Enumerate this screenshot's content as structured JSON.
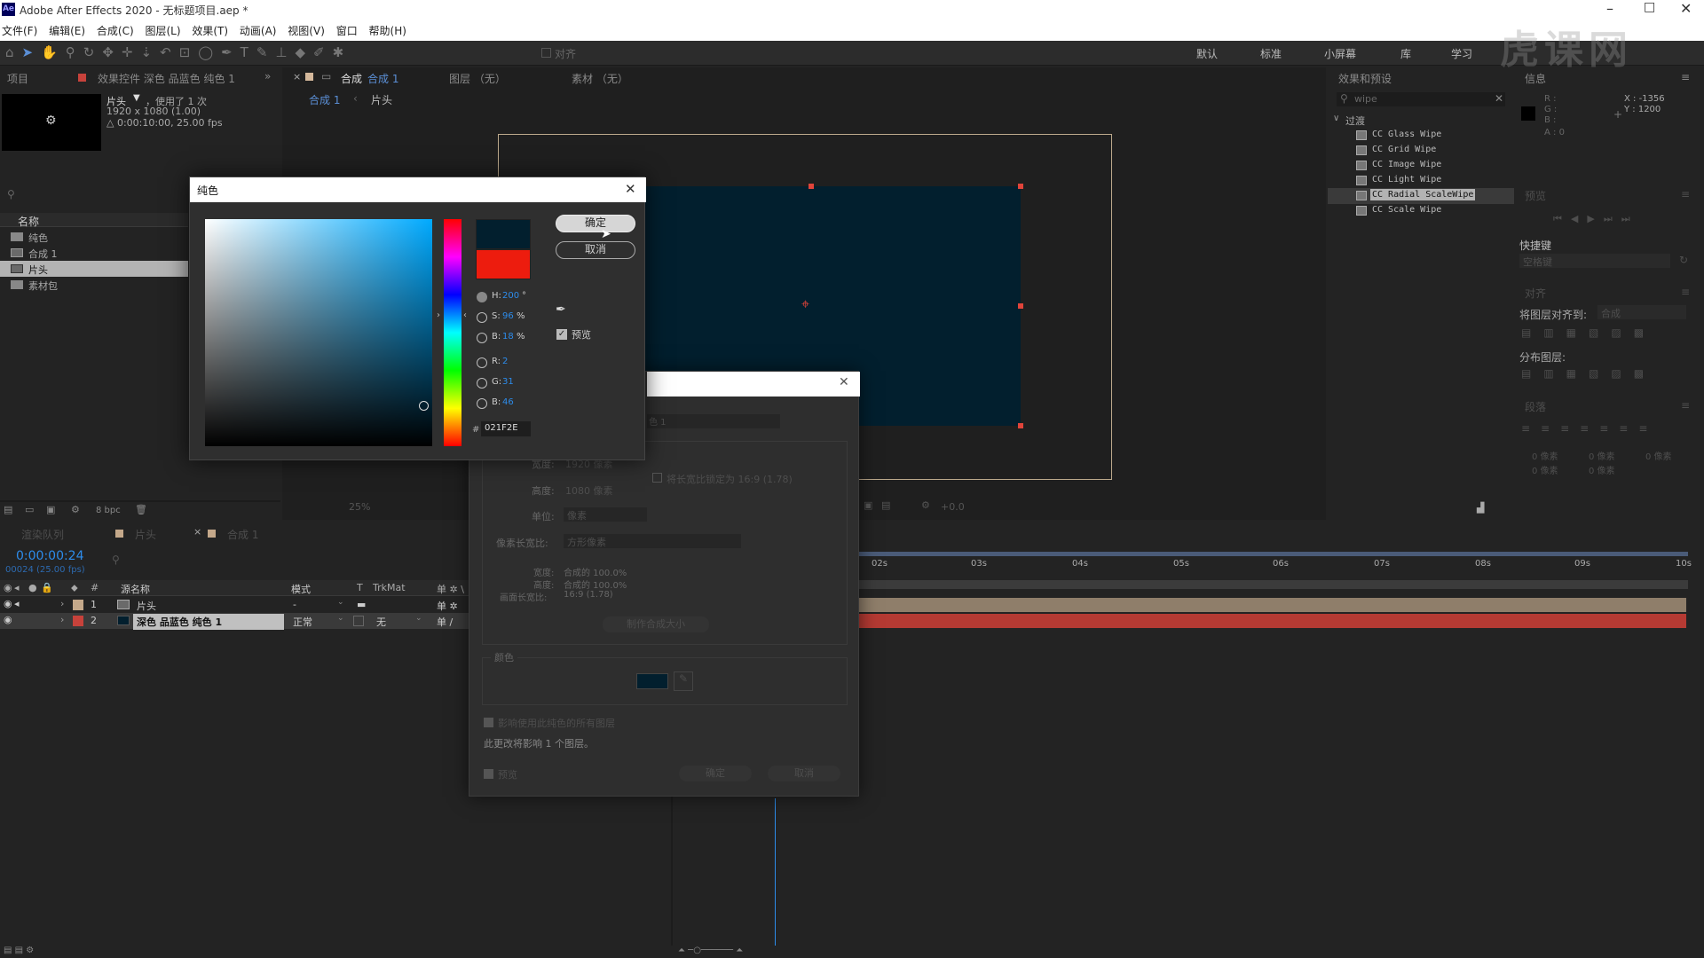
{
  "app": {
    "title": "Adobe After Effects 2020 - 无标题项目.aep *",
    "logo": "Ae"
  },
  "menu": [
    "文件(F)",
    "编辑(E)",
    "合成(C)",
    "图层(L)",
    "效果(T)",
    "动画(A)",
    "视图(V)",
    "窗口",
    "帮助(H)"
  ],
  "workspaces": [
    "默认",
    "标准",
    "小屏幕",
    "库",
    "学习"
  ],
  "toolbar": {
    "align_label": "对齐"
  },
  "watermark": "虎课网",
  "project": {
    "tabs": [
      "项目",
      "效果控件 深色 品蓝色 纯色 1"
    ],
    "item_name": "片头",
    "used": "，使用了 1 次",
    "size": "1920 x 1080 (1.00)",
    "duration": "△ 0:00:10:00, 25.00 fps",
    "col_name": "名称",
    "items": [
      {
        "name": "纯色",
        "type": "folder"
      },
      {
        "name": "合成 1",
        "type": "comp"
      },
      {
        "name": "片头",
        "type": "comp"
      },
      {
        "name": "素材包",
        "type": "folder"
      }
    ],
    "bpc": "8 bpc"
  },
  "comp": {
    "tabs": [
      "合成",
      "合成 1",
      "图层 （无）",
      "素材 （无）"
    ],
    "breadcrumb": [
      "合成 1",
      "片头"
    ],
    "zoom": "25%",
    "exposure": "+0.0"
  },
  "effects": {
    "title": "效果和预设",
    "search": "wipe",
    "group": "过渡",
    "items": [
      "CC Glass Wipe",
      "CC Grid Wipe",
      "CC Image Wipe",
      "CC Light Wipe",
      "CC Radial ScaleWipe",
      "CC Scale Wipe"
    ],
    "selected": "CC Radial ScaleWipe"
  },
  "info": {
    "title": "信息",
    "r": "R :",
    "g": "G :",
    "b": "B :",
    "a": "A : 0",
    "x": "X : -1356",
    "y": "Y : 1200"
  },
  "preview": {
    "title": "预览"
  },
  "shortcuts": {
    "title": "快捷键",
    "value": "空格键"
  },
  "align": {
    "title": "对齐",
    "align_to_label": "将图层对齐到:",
    "align_to_value": "合成",
    "distribute": "分布图层:"
  },
  "paragraph": {
    "title": "段落",
    "px": "0 像素"
  },
  "timeline": {
    "tabs": [
      "渲染队列",
      "片头",
      "合成 1"
    ],
    "time": "0:00:00:24",
    "frames": "00024 (25.00 fps)",
    "columns": [
      "#",
      "源名称",
      "模式",
      "T",
      "TrkMat"
    ],
    "layers": [
      {
        "num": "1",
        "name": "片头",
        "mode": "-",
        "trk": "",
        "color": "#c4a88a"
      },
      {
        "num": "2",
        "name": "深色 品蓝色 纯色 1",
        "mode": "正常",
        "trk": "无",
        "color": "#c7423b"
      }
    ],
    "ruler": [
      "02s",
      "03s",
      "04s",
      "05s",
      "06s",
      "07s",
      "08s",
      "09s",
      "10s"
    ]
  },
  "color_dialog": {
    "title": "纯色",
    "ok": "确定",
    "cancel": "取消",
    "preview": "预览",
    "h_label": "H:",
    "h_val": "200",
    "h_unit": "°",
    "s_label": "S:",
    "s_val": "96",
    "s_unit": "%",
    "b_label": "B:",
    "b_val": "18",
    "b_unit": "%",
    "r_label": "R:",
    "r_val": "2",
    "g_label": "G:",
    "g_val": "31",
    "bb_label": "B:",
    "bb_val": "46",
    "hex_label": "#",
    "hex": "021F2E",
    "new_color": "#021F2E",
    "old_color": "#ED1C0E"
  },
  "solid_dialog": {
    "name": "色 1",
    "width_label": "宽度:",
    "width_val": "1920 像素",
    "height_label": "高度:",
    "height_val": "1080 像素",
    "lock_ratio": "将长宽比锁定为 16:9 (1.78)",
    "unit_label": "单位:",
    "unit_val": "像素",
    "par_label": "像素长宽比:",
    "par_val": "方形像素",
    "w_pct_label": "宽度:",
    "w_pct": "合成的 100.0%",
    "h_pct_label": "高度:",
    "h_pct": "合成的 100.0%",
    "frame_label": "画面长宽比:",
    "frame_val": "16:9 (1.78)",
    "make_comp": "制作合成大小",
    "color_label": "颜色",
    "affect_all": "影响使用此纯色的所有图层",
    "affect_note": "此更改将影响 1 个图层。",
    "preview": "预览",
    "ok": "确定",
    "cancel": "取消",
    "swatch": "#021F2E"
  }
}
